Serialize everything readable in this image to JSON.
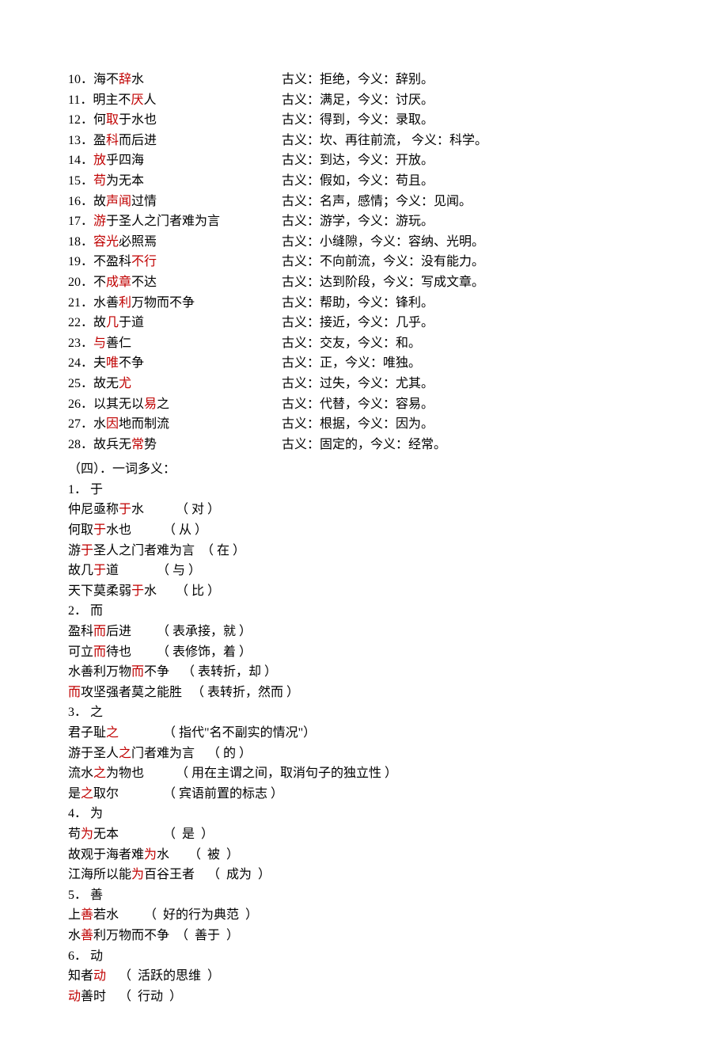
{
  "items": [
    {
      "num": "10．",
      "pre": "海不",
      "kw": "辞",
      "post": "水",
      "def": "古义：拒绝，今义：辞别。"
    },
    {
      "num": "11．",
      "pre": "明主不",
      "kw": "厌",
      "post": "人",
      "def": "古义：满足，今义：讨厌。"
    },
    {
      "num": "12．",
      "pre": "何",
      "kw": "取",
      "post": "于水也",
      "def": "古义：得到，今义：录取。"
    },
    {
      "num": "13．",
      "pre": "盈",
      "kw": "科",
      "post": "而后进",
      "def": "古义：坎、再往前流， 今义：科学。"
    },
    {
      "num": "14．",
      "pre": "",
      "kw": "放",
      "post": "乎四海",
      "def": "古义：到达，今义：开放。"
    },
    {
      "num": "15．",
      "pre": "",
      "kw": "苟",
      "post": "为无本",
      "def": "古义：假如，今义：苟且。"
    },
    {
      "num": "16．",
      "pre": "故",
      "kw": "声闻",
      "post": "过情",
      "def": "古义：名声，感情；今义：见闻。"
    },
    {
      "num": "17．",
      "pre": "",
      "kw": "游",
      "post": "于圣人之门者难为言",
      "def": "古义：游学，今义：游玩。"
    },
    {
      "num": "18．",
      "pre": "",
      "kw": "容光",
      "post": "必照焉",
      "def": "古义：小缝隙，今义：容纳、光明。"
    },
    {
      "num": "19．",
      "pre": "不盈科",
      "kw": "不行",
      "post": "",
      "def": "古义：不向前流，今义：没有能力。"
    },
    {
      "num": "20．",
      "pre": "不",
      "kw": "成章",
      "post": "不达",
      "def": "古义：达到阶段，今义：写成文章。"
    },
    {
      "num": "21．",
      "pre": "水善",
      "kw": "利",
      "post": "万物而不争",
      "def": "古义：帮助，今义：锋利。"
    },
    {
      "num": "22．",
      "pre": "故",
      "kw": "几",
      "post": "于道",
      "def": "古义：接近，今义：几乎。"
    },
    {
      "num": "23．",
      "pre": "",
      "kw": "与",
      "post": "善仁",
      "def": "古义：交友，今义：和。"
    },
    {
      "num": "24．",
      "pre": "夫",
      "kw": "唯",
      "post": "不争",
      "def": "古义：正，今义：唯独。"
    },
    {
      "num": "25．",
      "pre": "故无",
      "kw": "尤",
      "post": "",
      "def": "古义：过失，今义：尤其。"
    },
    {
      "num": "26．",
      "pre": "以其无以",
      "kw": "易",
      "post": "之",
      "def": "古义：代替，今义：容易。"
    },
    {
      "num": "27．",
      "pre": "水",
      "kw": "因",
      "post": "地而制流",
      "def": "古义：根据，今义：因为。"
    },
    {
      "num": "28．",
      "pre": "故兵无",
      "kw": "常",
      "post": "势",
      "def": "古义：固定的，今义：经常。"
    }
  ],
  "section4": "（四）．一词多义：",
  "g1": {
    "head": "1．  于",
    "rows": [
      {
        "pre": "仲尼亟称",
        "kw": "于",
        "post": "水",
        "gloss": "（ 对 ）",
        "pad": "          "
      },
      {
        "pre": "何取",
        "kw": "于",
        "post": "水也",
        "gloss": "（ 从 ）",
        "pad": "          "
      },
      {
        "pre": "游",
        "kw": "于",
        "post": "圣人之门者难为言",
        "gloss": "（ 在 ）",
        "pad": "  "
      },
      {
        "pre": "故几",
        "kw": "于",
        "post": "道",
        "gloss": "（ 与 ）",
        "pad": "            "
      },
      {
        "pre": "天下莫柔弱",
        "kw": "于",
        "post": "水",
        "gloss": "（ 比 ）",
        "pad": "      "
      }
    ]
  },
  "g2": {
    "head": "2．  而",
    "rows": [
      {
        "pre": "盈科",
        "kw": "而",
        "post": "后进",
        "gloss": "（ 表承接，就 ）",
        "pad": "        "
      },
      {
        "pre": "可立",
        "kw": "而",
        "post": "待也",
        "gloss": "（ 表修饰，着 ）",
        "pad": "        "
      },
      {
        "pre": "水善利万物",
        "kw": "而",
        "post": "不争",
        "gloss": "（ 表转折，却 ）",
        "pad": "    "
      },
      {
        "pre": "",
        "kw": "而",
        "post": "攻坚强者莫之能胜",
        "gloss": "（ 表转折，然而 ）",
        "pad": "   "
      }
    ]
  },
  "g3": {
    "head": "3．  之",
    "rows": [
      {
        "pre": "君子耻",
        "kw": "之",
        "post": "",
        "gloss": "（ 指代\"名不副实的情况\"）",
        "pad": "              "
      },
      {
        "pre": "游于圣人",
        "kw": "之",
        "post": "门者难为言",
        "gloss": "（ 的 ）",
        "pad": "    "
      },
      {
        "pre": "流水",
        "kw": "之",
        "post": "为物也",
        "gloss": "（ 用在主谓之间，取消句子的独立性 ）",
        "pad": "          "
      },
      {
        "pre": "是",
        "kw": "之",
        "post": "取尔",
        "gloss": "（ 宾语前置的标志 ）",
        "pad": "              "
      }
    ]
  },
  "g4": {
    "head": "4．  为",
    "rows": [
      {
        "pre": "苟",
        "kw": "为",
        "post": "无本",
        "gloss": "（  是  ）",
        "pad": "              "
      },
      {
        "pre": "故观于海者难",
        "kw": "为",
        "post": "水",
        "gloss": "（  被  ）",
        "pad": "      "
      },
      {
        "pre": "江海所以能",
        "kw": "为",
        "post": "百谷王者",
        "gloss": "（  成为  ）",
        "pad": "    "
      }
    ]
  },
  "g5": {
    "head": "5．  善",
    "rows": [
      {
        "pre": "上",
        "kw": "善",
        "post": "若水",
        "gloss": "（  好的行为典范  ）",
        "pad": "        "
      },
      {
        "pre": "水",
        "kw": "善",
        "post": "利万物而不争",
        "gloss": "（  善于  ）",
        "pad": "  "
      }
    ]
  },
  "g6": {
    "head": "6．  动",
    "rows": [
      {
        "pre": "知者",
        "kw": "动",
        "post": "",
        "gloss": "（  活跃的思维  ）",
        "pad": "    "
      },
      {
        "pre": "",
        "kw": "动",
        "post": "善时",
        "gloss": "（  行动  ）",
        "pad": "    "
      }
    ]
  }
}
